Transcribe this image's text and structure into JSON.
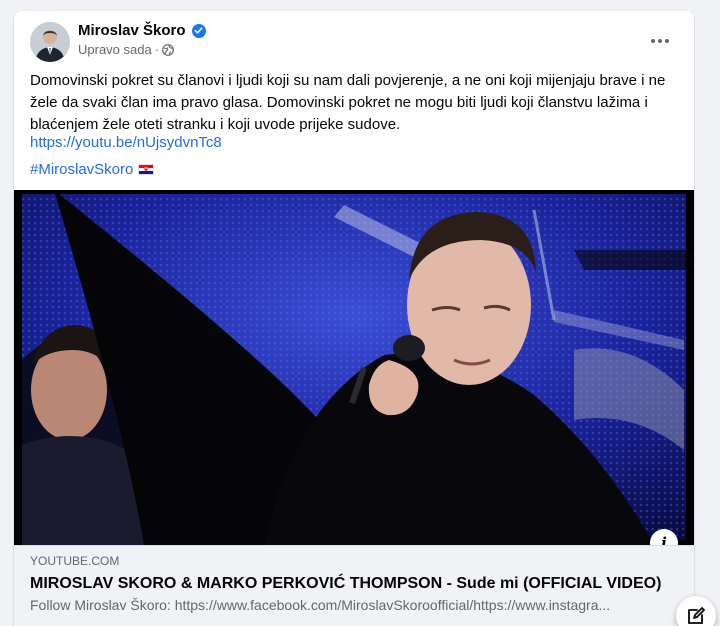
{
  "post": {
    "author": "Miroslav Škoro",
    "timestamp": "Upravo sada",
    "separator": "·",
    "body": "Domovinski pokret su članovi i ljudi koji su nam dali povjerenje, a ne oni koji mijenjaju brave i ne žele da svaki član ima pravo glasa. Domovinski pokret ne mogu biti ljudi koji članstvu lažima i blaćenjem žele oteti stranku i koji uvode prijeke sudove.",
    "link": "https://youtu.be/nUjsydvnTc8",
    "hashtag": "#MiroslavSkoro"
  },
  "link_preview": {
    "domain": "YOUTUBE.COM",
    "title": "MIROSLAV SKORO & MARKO PERKOVIĆ THOMPSON - Sude mi (OFFICIAL VIDEO)",
    "description": "Follow Miroslav Škoro: https://www.facebook.com/MiroslavSkoroofficial/https://www.instagra..."
  },
  "icons": {
    "verified": "verified-badge-icon",
    "audience": "globe-icon",
    "more": "more-options-icon",
    "flag": "croatia-flag-icon",
    "info": "info-icon",
    "compose": "new-message-icon"
  },
  "colors": {
    "link": "#216fdb",
    "verified": "#1877f2",
    "secondary_text": "#65676b",
    "background": "#f0f2f5"
  }
}
